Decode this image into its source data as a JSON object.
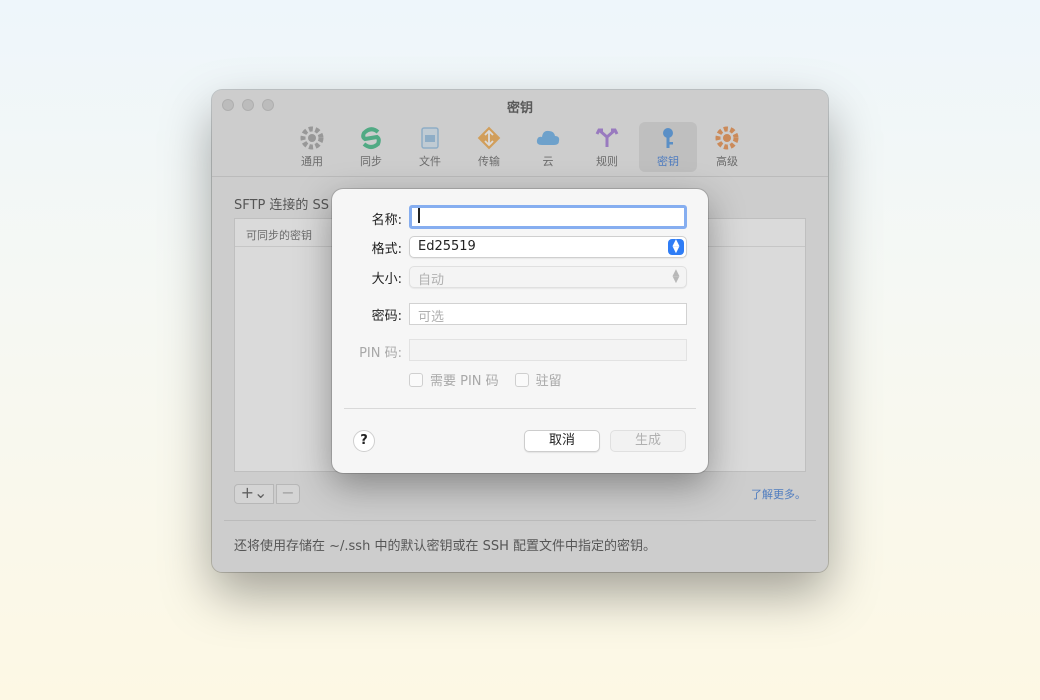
{
  "window": {
    "title": "密钥",
    "toolbar": [
      {
        "label": "通用",
        "icon": "gear-icon",
        "color": "#9a9a9a"
      },
      {
        "label": "同步",
        "icon": "sync-icon",
        "color": "#2db67c"
      },
      {
        "label": "文件",
        "icon": "file-icon",
        "color": "#8bbbe0"
      },
      {
        "label": "传输",
        "icon": "transfer-icon",
        "color": "#f2a43c"
      },
      {
        "label": "云",
        "icon": "cloud-icon",
        "color": "#5aa8e8"
      },
      {
        "label": "规则",
        "icon": "rules-icon",
        "color": "#9b6cd6"
      },
      {
        "label": "密钥",
        "icon": "key-icon",
        "color": "#3b8de0"
      },
      {
        "label": "高级",
        "icon": "advanced-gear-icon",
        "color": "#e8843a"
      }
    ],
    "content_title": "SFTP 连接的 SS",
    "table_header": "可同步的密钥",
    "add_button": "+⌄",
    "remove_button": "−",
    "learn_more": "了解更多。",
    "footer_text": "还将使用存储在 ~/.ssh 中的默认密钥或在 SSH 配置文件中指定的密钥。"
  },
  "sheet": {
    "name_label": "名称:",
    "name_value": "",
    "format_label": "格式:",
    "format_value": "Ed25519",
    "size_label": "大小:",
    "size_value": "自动",
    "password_label": "密码:",
    "password_placeholder": "可选",
    "pin_label": "PIN 码:",
    "require_pin_label": "需要 PIN 码",
    "resident_label": "驻留",
    "help_label": "?",
    "cancel_label": "取消",
    "generate_label": "生成"
  }
}
